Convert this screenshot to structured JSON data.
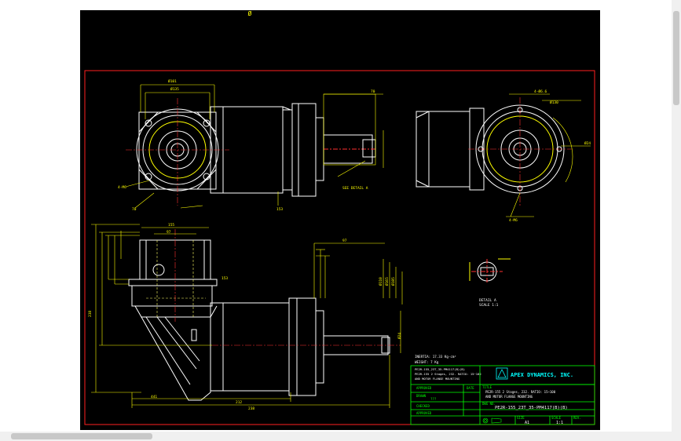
{
  "sheet": {
    "top_mark": "Ø",
    "balloon": "A"
  },
  "labels": {
    "detail_a": "DETAIL A",
    "detail_a_2": "SCALE 1:1",
    "see_detail": "SEE DETAIL A",
    "mass1": "INERTIA: 17.33 Kg-cm²",
    "mass2": "WEIGHT: 7 Kg"
  },
  "title_block": {
    "company": "APEX DYNAMICS, INC.",
    "desc1": "PE2R-155 2 Stages, 232. RATIO: 15~100",
    "desc2": "AND MOTOR FLANGE MOUNTING",
    "drawing_no": "PE2R-155_23T_35-PM4117(B)(B)",
    "row_approved": "APPROVED",
    "row_date": "DATE",
    "row_drawn": "DRAWN",
    "row_checked": "CHECKED",
    "row_approve2": "APPROVED",
    "title_lbl": "TITLE",
    "dwg_lbl": "DWG NO.",
    "size_lbl": "SIZE",
    "size": "A1",
    "scale_lbl": "SCALE",
    "scale": "1:1",
    "sheet_lbl": "REV.",
    "drawn_val": "???"
  },
  "dims": {
    "d1": "Ø101",
    "d2": "Ø135",
    "d3": "4-M6",
    "d4": "70",
    "d5": "Ø130",
    "d6": "153",
    "d7": "4-Ø6.6",
    "d8": "155",
    "d9": "238",
    "d10": "212",
    "d11": "441",
    "d12": "97",
    "d13": "Ø24",
    "d14": "Ø110",
    "d15": "Ø165",
    "d16": "Ø185"
  },
  "colors": {
    "background": "#000000",
    "border_red": "#ff2020",
    "outline": "#ffffff",
    "dimension": "#ffff00",
    "centerline": "#ff3030",
    "hidden": "#ffff66",
    "titleblock": "#00ff00",
    "logo": "#00ffff"
  }
}
